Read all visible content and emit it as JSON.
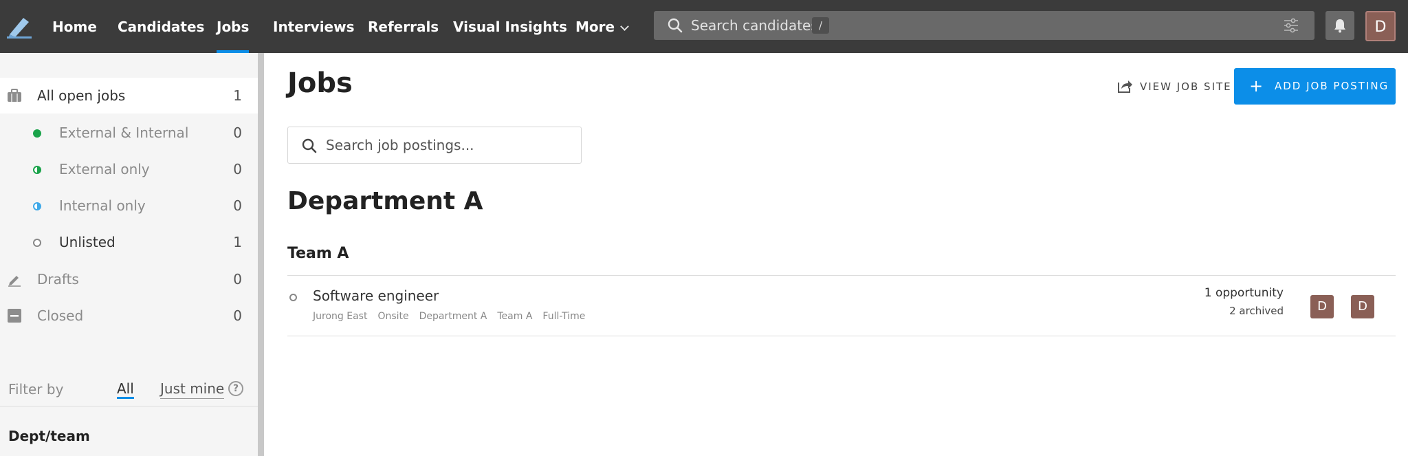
{
  "nav": {
    "items": [
      "Home",
      "Candidates",
      "Jobs",
      "Interviews",
      "Referrals",
      "Visual Insights",
      "More"
    ],
    "search_placeholder": "Search candidates",
    "search_shortcut": "/",
    "user_initial": "D"
  },
  "sidebar": {
    "items": [
      {
        "label": "All open jobs",
        "count": "1"
      },
      {
        "label": "External & Internal",
        "count": "0"
      },
      {
        "label": "External only",
        "count": "0"
      },
      {
        "label": "Internal only",
        "count": "0"
      },
      {
        "label": "Unlisted",
        "count": "1"
      },
      {
        "label": "Drafts",
        "count": "0"
      },
      {
        "label": "Closed",
        "count": "0"
      }
    ],
    "filter_label": "Filter by",
    "filter_all": "All",
    "filter_mine": "Just mine",
    "help": "?",
    "dept_heading": "Dept/team"
  },
  "main": {
    "title": "Jobs",
    "view_site": "VIEW JOB SITE",
    "add_posting": "ADD JOB POSTING",
    "search_placeholder": "Search job postings...",
    "department": "Department A",
    "team": "Team A",
    "job": {
      "title": "Software engineer",
      "tags": [
        "Jurong East",
        "Onsite",
        "Department A",
        "Team A",
        "Full-Time"
      ],
      "opportunities": "1 opportunity",
      "archived": "2 archived",
      "owners": [
        "D",
        "D"
      ]
    }
  },
  "colors": {
    "accent": "#0c8ee8",
    "nav_bg": "#3b3b3b",
    "avatar": "#8a5f56",
    "status_green": "#1aa34a",
    "status_blue": "#3fa9e8"
  }
}
